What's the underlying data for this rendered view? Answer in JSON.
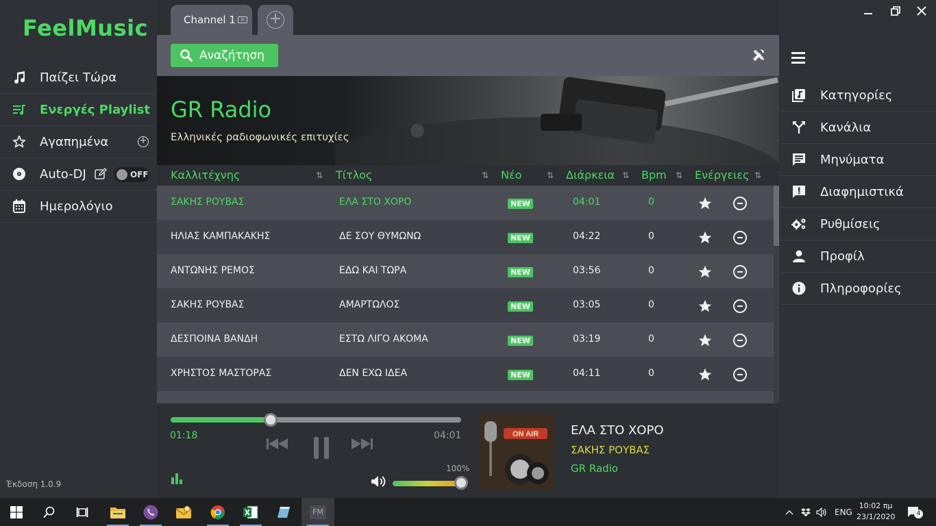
{
  "app": {
    "logo_part1": "Feel",
    "logo_part2": "M",
    "logo_part3": "usic",
    "version": "Έκδοση 1.0.9"
  },
  "left_nav": [
    {
      "label": "Παίζει Τώρα",
      "icon": "music-note-icon"
    },
    {
      "label": "Ενεργές Playlist",
      "icon": "playlist-icon",
      "active": true
    },
    {
      "label": "Αγαπημένα",
      "icon": "star-outline-icon"
    },
    {
      "label": "Auto-DJ",
      "icon": "disc-icon",
      "toggle": "OFF"
    },
    {
      "label": "Ημερολόγιο",
      "icon": "calendar-icon"
    }
  ],
  "tabs": [
    {
      "label": "Channel 1"
    }
  ],
  "toolbar": {
    "search_label": "Αναζήτηση"
  },
  "banner": {
    "title": "GR Radio",
    "subtitle": "Ελληνικές ραδιοφωνικές επιτυχίες"
  },
  "table": {
    "headers": [
      "Καλλιτέχνης",
      "Τίτλος",
      "Νέο",
      "Διάρκεια",
      "Bpm",
      "Ενέργειες"
    ],
    "rows": [
      {
        "artist": "ΣΑΚΗΣ ΡΟΥΒΑΣ",
        "title": "ΕΛΑ ΣΤΟ ΧΟΡΟ",
        "new": "NEW",
        "duration": "04:01",
        "bpm": "0",
        "playing": true
      },
      {
        "artist": "ΗΛΙΑΣ ΚΑΜΠΑΚΑΚΗΣ",
        "title": "ΔΕ ΣΟΥ ΘΥΜΩΝΩ",
        "new": "NEW",
        "duration": "04:22",
        "bpm": "0"
      },
      {
        "artist": "ΑΝΤΩΝΗΣ ΡΕΜΟΣ",
        "title": "ΕΔΩ ΚΑΙ ΤΩΡΑ",
        "new": "NEW",
        "duration": "03:56",
        "bpm": "0"
      },
      {
        "artist": "ΣΑΚΗΣ ΡΟΥΒΑΣ",
        "title": "ΑΜΑΡΤΩΛΟΣ",
        "new": "NEW",
        "duration": "03:05",
        "bpm": "0"
      },
      {
        "artist": "ΔΕΣΠΟΙΝΑ ΒΑΝΔΗ",
        "title": "ΕΣΤΩ ΛΙΓΟ ΑΚΟΜΑ",
        "new": "NEW",
        "duration": "03:19",
        "bpm": "0"
      },
      {
        "artist": "ΧΡΗΣΤΟΣ ΜΑΣΤΟΡΑΣ",
        "title": "ΔΕΝ ΕΧΩ ΙΔΕΑ",
        "new": "NEW",
        "duration": "04:11",
        "bpm": "0"
      }
    ]
  },
  "player": {
    "current_time": "01:18",
    "total_time": "04:01",
    "progress_fraction": 0.345,
    "volume_label": "100%",
    "now_playing_title": "ΕΛΑ ΣΤΟ ΧΟΡΟ",
    "now_playing_artist": "ΣΑΚΗΣ ΡΟΥΒΑΣ",
    "now_playing_channel": "GR Radio",
    "art_text": "ON AIR"
  },
  "right_nav": [
    {
      "label": "Κατηγορίες",
      "icon": "categories-icon"
    },
    {
      "label": "Κανάλια",
      "icon": "channels-icon"
    },
    {
      "label": "Μηνύματα",
      "icon": "messages-icon"
    },
    {
      "label": "Διαφημιστικά",
      "icon": "ads-icon"
    },
    {
      "label": "Ρυθμίσεις",
      "icon": "settings-icon"
    },
    {
      "label": "Προφίλ",
      "icon": "profile-icon"
    },
    {
      "label": "Πληροφορίες",
      "icon": "info-icon"
    }
  ],
  "taskbar": {
    "lang": "ENG",
    "time": "10:02 πμ",
    "date": "23/1/2020",
    "notifications": "4",
    "fm_label": "FM"
  },
  "colors": {
    "accent": "#4cd964",
    "button_green": "#4cc462",
    "artist_yellow": "#d8d84a"
  }
}
